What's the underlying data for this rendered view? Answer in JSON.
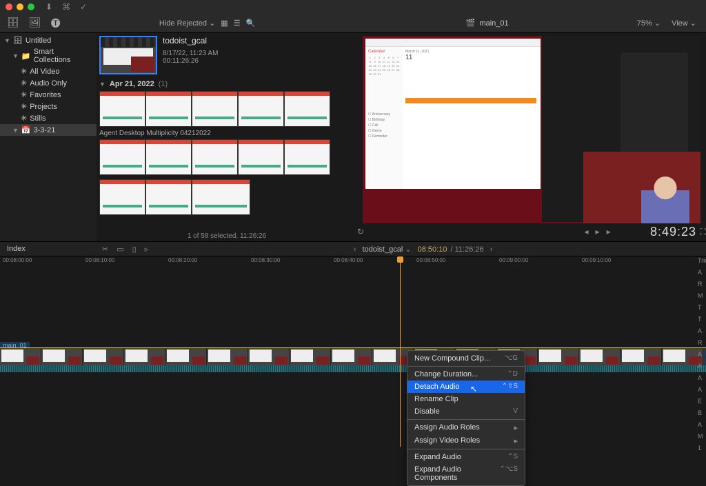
{
  "titlebar": {
    "icons": [
      "download-icon",
      "link-icon",
      "check-icon"
    ]
  },
  "toolbar": {
    "hide_rejected": "Hide Rejected",
    "project_title": "main_01",
    "zoom": "75%",
    "view": "View"
  },
  "sidebar": {
    "library": "Untitled",
    "items": [
      {
        "label": "Smart Collections"
      },
      {
        "label": "All Video"
      },
      {
        "label": "Audio Only"
      },
      {
        "label": "Favorites"
      },
      {
        "label": "Projects"
      },
      {
        "label": "Stills"
      }
    ],
    "event": "3-3-21"
  },
  "browser": {
    "clip_name": "todoist_gcal",
    "date": "8/17/22, 11:23 AM",
    "duration": "00:11:26:26",
    "group_date": "Apr 21, 2022",
    "group_count": "(1)",
    "caption": "Agent Desktop Multiplicity 04212022",
    "status": "1 of 58 selected, 11:26:26"
  },
  "viewer": {
    "calendar_label": "Calendar",
    "date_label": "March 11, 2021",
    "big_day": "11",
    "checklist": [
      "Anniversary",
      "Birthday",
      "Call",
      "Game",
      "Reminder"
    ],
    "timecode": "8:49:23"
  },
  "subheader": {
    "index": "Index",
    "project": "todoist_gcal",
    "tc": "08:50:10",
    "dur": "/ 11:26:26"
  },
  "ruler": {
    "ticks": [
      "00:08:00:00",
      "00:08:10:00",
      "00:08:20:00",
      "00:08:30:00",
      "00:08:40:00",
      "00:08:50:00",
      "00:09:00:00",
      "00:09:10:00"
    ]
  },
  "timeline": {
    "clip_label": "main_01"
  },
  "context_menu": {
    "items": [
      {
        "label": "New Compound Clip...",
        "shortcut": "⌥G"
      },
      {
        "sep": true
      },
      {
        "label": "Change Duration...",
        "shortcut": "⌃D"
      },
      {
        "label": "Detach Audio",
        "shortcut": "⌃⇧S",
        "highlighted": true
      },
      {
        "label": "Rename Clip"
      },
      {
        "label": "Disable",
        "shortcut": "V"
      },
      {
        "sep": true
      },
      {
        "label": "Assign Audio Roles",
        "submenu": true
      },
      {
        "label": "Assign Video Roles",
        "submenu": true
      },
      {
        "sep": true
      },
      {
        "label": "Expand Audio",
        "shortcut": "⌃S"
      },
      {
        "label": "Expand Audio Components",
        "shortcut": "⌃⌥S"
      }
    ]
  },
  "side_letters": [
    "Trk",
    "A",
    "R",
    "M",
    "T",
    "T",
    "A",
    "R",
    "A",
    "A",
    "A",
    "A",
    "E",
    "B",
    "A",
    "M",
    "",
    "1"
  ]
}
